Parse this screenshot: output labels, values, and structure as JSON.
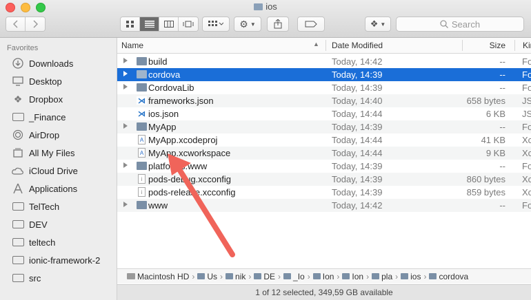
{
  "window": {
    "title": "ios"
  },
  "toolbar": {
    "back_icon": "chevron-left-icon",
    "forward_icon": "chevron-right-icon",
    "view_modes": [
      "icon-view",
      "list-view",
      "column-view",
      "cover-flow-view"
    ],
    "selected_view": "list-view",
    "search_placeholder": "Search"
  },
  "sidebar": {
    "heading": "Favorites",
    "items": [
      {
        "label": "Downloads",
        "icon": "downloads-icon"
      },
      {
        "label": "Desktop",
        "icon": "desktop-icon"
      },
      {
        "label": "Dropbox",
        "icon": "dropbox-icon"
      },
      {
        "label": "_Finance",
        "icon": "folder-icon"
      },
      {
        "label": "AirDrop",
        "icon": "airdrop-icon"
      },
      {
        "label": "All My Files",
        "icon": "all-files-icon"
      },
      {
        "label": "iCloud Drive",
        "icon": "cloud-icon"
      },
      {
        "label": "Applications",
        "icon": "applications-icon"
      },
      {
        "label": "TelTech",
        "icon": "folder-icon"
      },
      {
        "label": "DEV",
        "icon": "folder-icon"
      },
      {
        "label": "teltech",
        "icon": "folder-icon"
      },
      {
        "label": "ionic-framework-2",
        "icon": "folder-icon"
      },
      {
        "label": "src",
        "icon": "folder-icon"
      }
    ]
  },
  "columns": {
    "name": "Name",
    "date": "Date Modified",
    "size": "Size",
    "kind": "Kir"
  },
  "files": [
    {
      "name": "build",
      "date": "Today, 14:42",
      "size": "--",
      "kind": "Fo",
      "type": "folder"
    },
    {
      "name": "cordova",
      "date": "Today, 14:39",
      "size": "--",
      "kind": "Fo",
      "type": "folder",
      "selected": true
    },
    {
      "name": "CordovaLib",
      "date": "Today, 14:39",
      "size": "--",
      "kind": "Fo",
      "type": "folder"
    },
    {
      "name": "frameworks.json",
      "date": "Today, 14:40",
      "size": "658 bytes",
      "kind": "JS",
      "type": "vscode"
    },
    {
      "name": "ios.json",
      "date": "Today, 14:44",
      "size": "6 KB",
      "kind": "JS",
      "type": "vscode"
    },
    {
      "name": "MyApp",
      "date": "Today, 14:39",
      "size": "--",
      "kind": "Fo",
      "type": "folder"
    },
    {
      "name": "MyApp.xcodeproj",
      "date": "Today, 14:44",
      "size": "41 KB",
      "kind": "Xc",
      "type": "xcode"
    },
    {
      "name": "MyApp.xcworkspace",
      "date": "Today, 14:44",
      "size": "9 KB",
      "kind": "Xc",
      "type": "xcode"
    },
    {
      "name": "platforms.www",
      "date": "Today, 14:39",
      "size": "--",
      "kind": "Fo",
      "type": "folder"
    },
    {
      "name": "pods-debug.xcconfig",
      "date": "Today, 14:39",
      "size": "860 bytes",
      "kind": "Xc",
      "type": "text"
    },
    {
      "name": "pods-release.xcconfig",
      "date": "Today, 14:39",
      "size": "859 bytes",
      "kind": "Xc",
      "type": "text"
    },
    {
      "name": "www",
      "date": "Today, 14:42",
      "size": "--",
      "kind": "Fo",
      "type": "folder"
    }
  ],
  "path": [
    "Macintosh HD",
    "Us",
    "nik",
    "DE",
    "_Io",
    "Ion",
    "Ion",
    "pla",
    "ios",
    "cordova"
  ],
  "status": "1 of 12 selected, 349,59 GB available",
  "colors": {
    "selection": "#1a6ed8",
    "annotation_arrow": "#f0645a"
  }
}
